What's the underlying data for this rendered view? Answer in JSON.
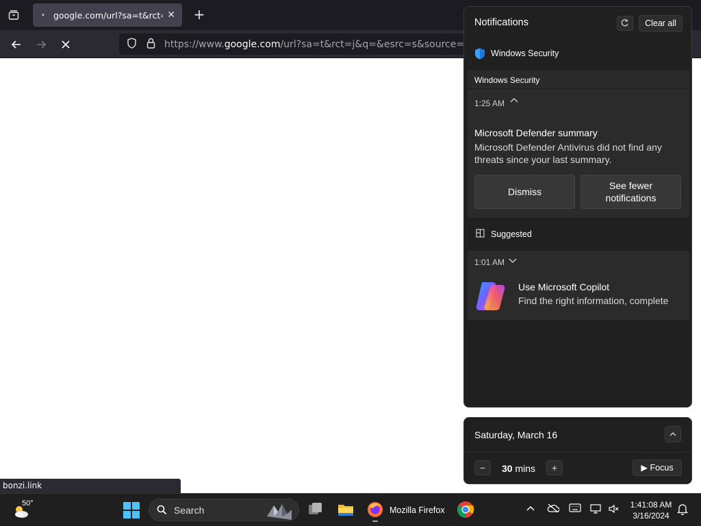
{
  "browser": {
    "tab_title": "google.com/url?sa=t&rct=j&q",
    "url_prefix": "https://www.",
    "url_domain": "google.com",
    "url_rest": "/url?sa=t&rct=j&q=&esrc=s&source=web&cd=",
    "status_link": "bonzi.link"
  },
  "notifications": {
    "title": "Notifications",
    "clear_all": "Clear all",
    "app_name": "Windows Security",
    "group_header": "Windows Security",
    "card1": {
      "time": "1:25 AM",
      "headline": "Microsoft Defender summary",
      "body": "Microsoft Defender Antivirus did not find any threats since your last summary.",
      "dismiss": "Dismiss",
      "see_fewer": "See fewer notifications"
    },
    "suggested_label": "Suggested",
    "card2": {
      "time": "1:01 AM",
      "headline": "Use Microsoft Copilot",
      "body": "Find the right information, complete"
    }
  },
  "calendar": {
    "date": "Saturday, March 16",
    "focus_minutes": "30",
    "focus_unit": "mins",
    "focus_button": "Focus"
  },
  "taskbar": {
    "temperature": "50°",
    "search_label": "Search",
    "firefox_label": "Mozilla Firefox",
    "time": "1:41:08 AM",
    "date": "3/16/2024"
  },
  "icons": {
    "shield": "shield-icon",
    "copilot": "copilot-icon",
    "start": "windows-start-icon"
  }
}
